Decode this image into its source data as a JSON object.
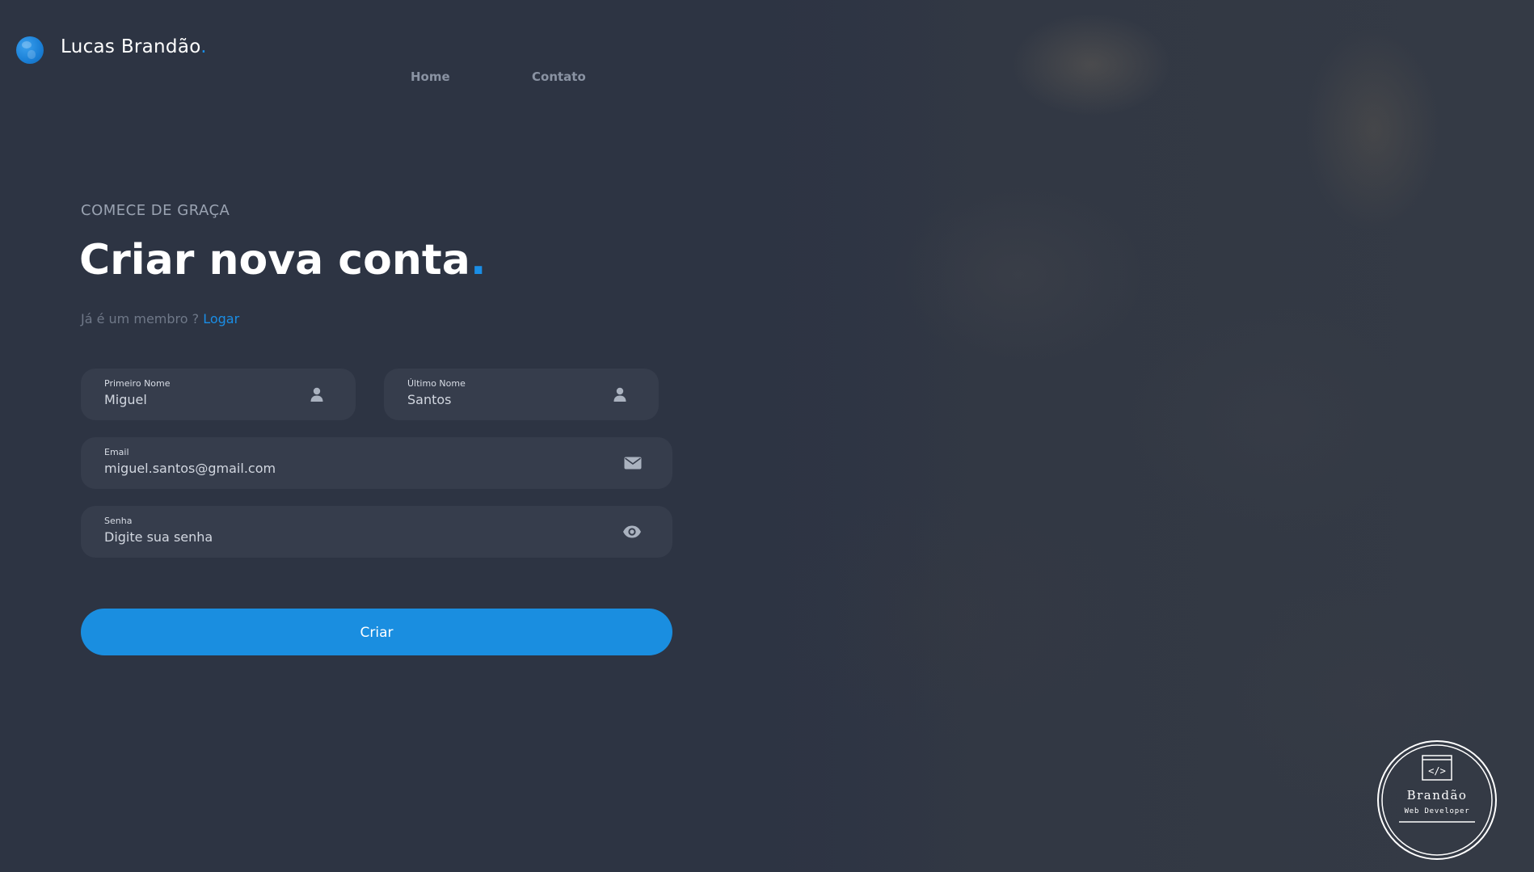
{
  "header": {
    "brand_name": "Lucas Brandão",
    "brand_dot": ".",
    "nav": [
      {
        "label": "Home"
      },
      {
        "label": "Contato"
      }
    ]
  },
  "form": {
    "eyebrow": "COMECE DE GRAÇA",
    "title": "Criar nova conta",
    "title_dot": ".",
    "member_prompt": "Já é um membro ? ",
    "login_link": "Logar",
    "fields": {
      "first_name": {
        "label": "Primeiro Nome",
        "value": "Miguel",
        "icon": "user-icon"
      },
      "last_name": {
        "label": "Último Nome",
        "value": "Santos",
        "icon": "user-icon"
      },
      "email": {
        "label": "Email",
        "value": "miguel.santos@gmail.com",
        "icon": "envelope-icon"
      },
      "password": {
        "label": "Senha",
        "placeholder": "Digite sua senha",
        "icon": "eye-icon"
      }
    },
    "submit_label": "Criar"
  },
  "badge": {
    "name": "Brandão",
    "subtitle": "Web Developer",
    "icon": "code-window-icon"
  },
  "colors": {
    "accent": "#1a8ee6",
    "background": "#2d3443",
    "field_bg": "#363d4c"
  }
}
